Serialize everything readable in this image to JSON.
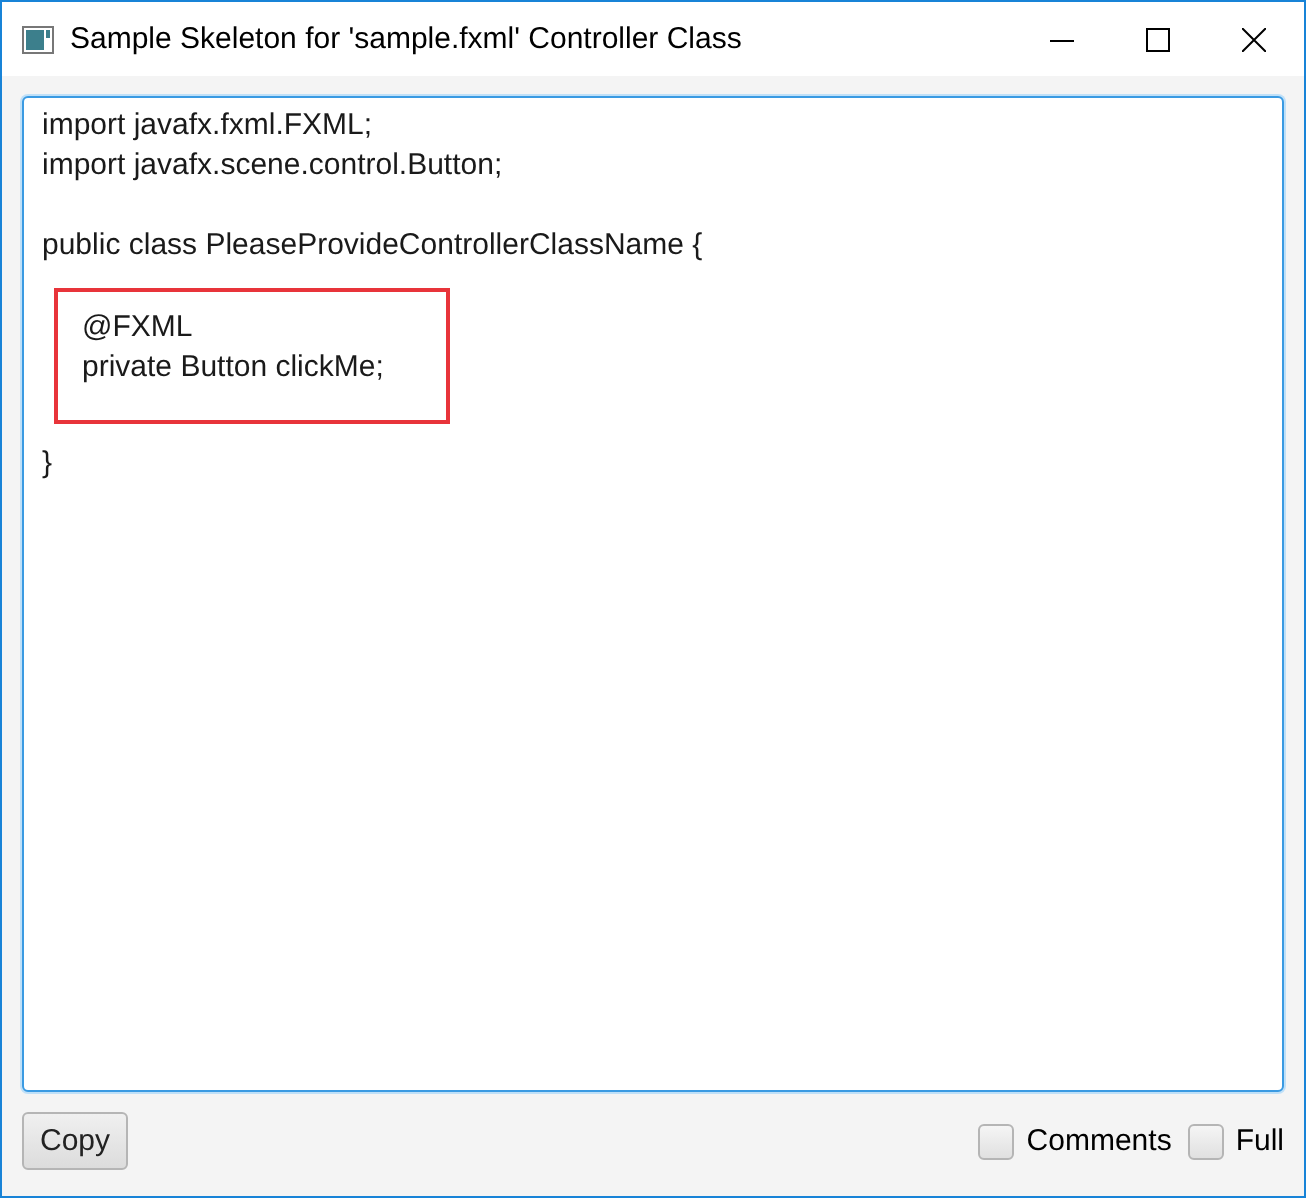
{
  "window": {
    "title": "Sample Skeleton for 'sample.fxml' Controller Class"
  },
  "code": {
    "blocks": [
      {
        "lines": [
          "import javafx.fxml.FXML;",
          "import javafx.scene.control.Button;"
        ],
        "indented": false,
        "highlighted": false
      },
      {
        "lines": [
          "public class PleaseProvideControllerClassName {"
        ],
        "indented": false,
        "highlighted": false
      },
      {
        "lines": [
          "@FXML",
          "private Button clickMe;"
        ],
        "indented": true,
        "highlighted": true
      },
      {
        "lines": [
          "}"
        ],
        "indented": false,
        "highlighted": false
      }
    ]
  },
  "buttons": [
    {
      "label": "Copy"
    }
  ],
  "checkboxes": [
    {
      "label": "Comments",
      "checked": false
    },
    {
      "label": "Full",
      "checked": false
    }
  ]
}
